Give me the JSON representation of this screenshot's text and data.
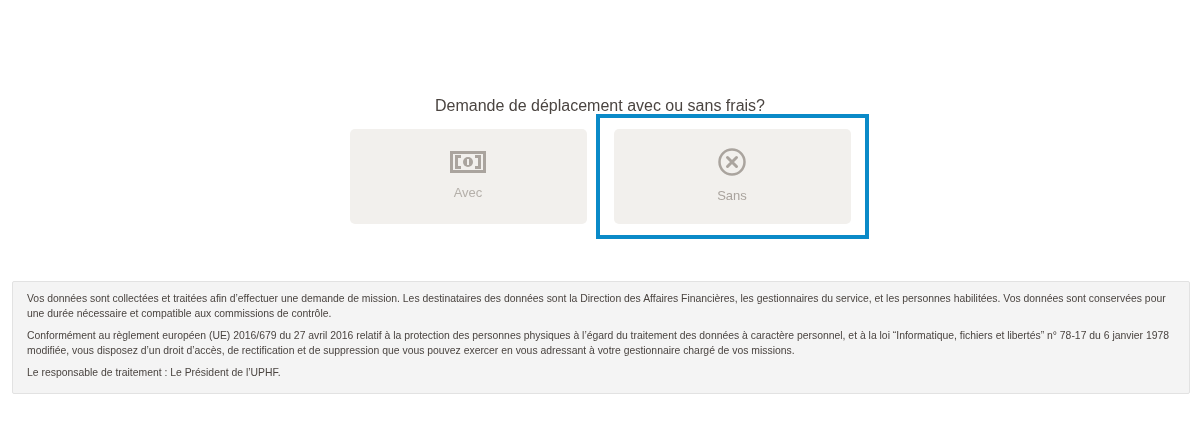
{
  "question": "Demande de déplacement avec ou sans frais?",
  "options": [
    {
      "label": "Avec",
      "kind": "money",
      "selected": false
    },
    {
      "label": "Sans",
      "kind": "none",
      "selected": true
    }
  ],
  "notice": [
    "Vos données sont collectées et traitées afin d’effectuer une demande de mission. Les destinataires des données sont la Direction des Affaires Financières, les gestionnaires du service, et les personnes habilitées. Vos données sont conservées pour une durée nécessaire et compatible aux commissions de contrôle.",
    "Conformément au règlement européen (UE) 2016/679 du 27 avril 2016 relatif à la protection des personnes physiques à l’égard du traitement des données à caractère personnel, et à la loi “Informatique, fichiers et libertés” n° 78-17 du 6 janvier 1978 modifiée, vous disposez d’un droit d’accès, de rectification et de suppression que vous pouvez exercer en vous adressant à votre gestionnaire chargé de vos missions.",
    "Le responsable de traitement : Le Président de l’UPHF."
  ]
}
